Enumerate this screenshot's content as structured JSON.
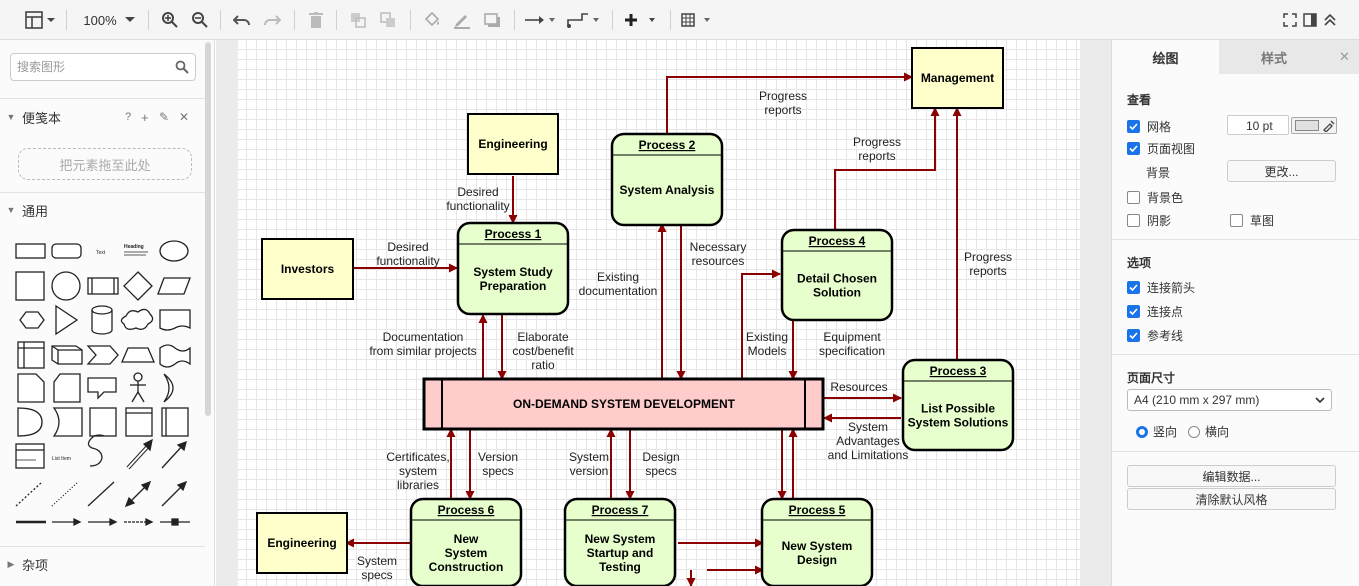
{
  "toolbar": {
    "zoom": "100%"
  },
  "left": {
    "search_placeholder": "搜索图形",
    "scratchpad": {
      "title": "便笺本",
      "actions": [
        "?",
        "+",
        "✎",
        "✕"
      ],
      "drop_hint": "把元素拖至此处"
    },
    "general": {
      "title": "通用"
    },
    "misc": {
      "title": "杂项"
    },
    "shape_text": {
      "text": "Text",
      "heading": "Heading",
      "list_item": "List Item"
    }
  },
  "diagram": {
    "nodes": {
      "management": "Management",
      "engineering_top": "Engineering",
      "investors": "Investors",
      "engineering_bottom": "Engineering",
      "central": "ON-DEMAND SYSTEM DEVELOPMENT",
      "p1": {
        "title": "Process 1",
        "lines": [
          "System Study",
          "Preparation"
        ]
      },
      "p2": {
        "title": "Process 2",
        "lines": [
          "System Analysis"
        ]
      },
      "p3": {
        "title": "Process 3",
        "lines": [
          "List Possible",
          "System Solutions"
        ]
      },
      "p4": {
        "title": "Process 4",
        "lines": [
          "Detail Chosen",
          "Solution"
        ]
      },
      "p5": {
        "title": "Process 5",
        "lines": [
          "New System",
          "Design"
        ]
      },
      "p6": {
        "title": "Process 6",
        "lines": [
          "New",
          "System",
          "Construction"
        ]
      },
      "p7": {
        "title": "Process 7",
        "lines": [
          "New System",
          "Startup and",
          "Testing"
        ]
      }
    },
    "labels": {
      "progress1": [
        "Progress",
        "reports"
      ],
      "progress2": [
        "Progress",
        "reports"
      ],
      "progress3": [
        "Progress",
        "reports"
      ],
      "desired1": [
        "Desired",
        "functionality"
      ],
      "desired2": [
        "Desired",
        "functionality"
      ],
      "necessary": [
        "Necessary",
        "resources"
      ],
      "existing_doc": [
        "Existing",
        "documentation"
      ],
      "doc_similar": [
        "Documentation",
        "from similar projects"
      ],
      "elaborate": [
        "Elaborate",
        "cost/benefit",
        "ratio"
      ],
      "existing_models": [
        "Existing",
        "Models"
      ],
      "equipment": [
        "Equipment",
        "specification"
      ],
      "resources": [
        "Resources"
      ],
      "sys_adv": [
        "System",
        "Advantages",
        "and Limitations"
      ],
      "certificates": [
        "Certificates,",
        "system",
        "libraries"
      ],
      "version": [
        "Version",
        "specs"
      ],
      "sys_version": [
        "System",
        "version"
      ],
      "design_specs": [
        "Design",
        "specs"
      ],
      "system_specs": [
        "System",
        "specs"
      ]
    }
  },
  "right": {
    "tabs": [
      "绘图",
      "样式"
    ],
    "close": "✕",
    "view": {
      "title": "查看",
      "grid": "网格",
      "grid_size": "10 pt",
      "page_view": "页面视图",
      "background": "背景",
      "change_button": "更改...",
      "background_color": "背景色",
      "shadow": "阴影",
      "sketch": "草图"
    },
    "options": {
      "title": "选项",
      "connection_arrows": "连接箭头",
      "connection_points": "连接点",
      "guides": "参考线"
    },
    "page_size": {
      "title": "页面尺寸",
      "selected": "A4 (210 mm x 297 mm)",
      "portrait": "竖向",
      "landscape": "横向"
    },
    "edit_data": "编辑数据...",
    "clear_style": "清除默认风格"
  },
  "colors": {
    "accent": "#1a73e8",
    "arrow": "#8b0000",
    "process_fill": "#e6ffcc",
    "entity_fill": "#ffffcc",
    "central_fill": "#ffcccc"
  }
}
